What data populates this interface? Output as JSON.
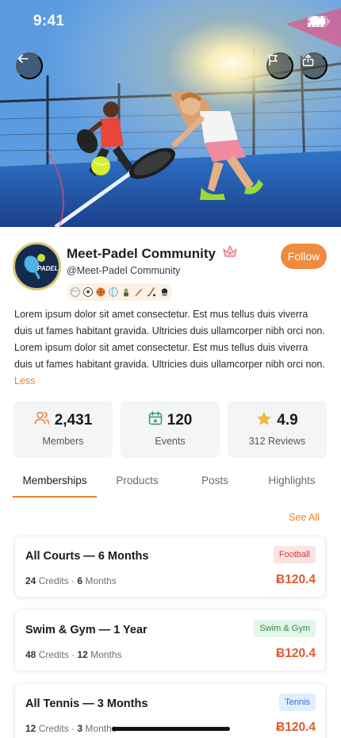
{
  "status_bar": {
    "time": "9:41"
  },
  "community": {
    "name": "Meet-Padel Community",
    "handle": "@Meet-Padel Community",
    "follow_label": "Follow",
    "logo_text": "PADEL",
    "sports_icons": [
      "tennis-ball-icon",
      "soccer-ball-icon",
      "basketball-icon",
      "volleyball-icon",
      "golf-icon",
      "padel-racket-icon",
      "hockey-icon",
      "boxing-glove-icon"
    ],
    "description": "Lorem ipsum dolor sit amet consectetur. Est mus tellus duis viverra duis ut fames habitant gravida. Ultricies duis ullamcorper nibh orci non. Lorem ipsum dolor sit amet consectetur. Est mus tellus duis viverra duis ut fames habitant gravida. Ultricies duis ullamcorper nibh orci non.",
    "less_label": "Less"
  },
  "stats": [
    {
      "value": "2,431",
      "label": "Members",
      "icon": "users-icon"
    },
    {
      "value": "120",
      "label": "Events",
      "icon": "calendar-icon"
    },
    {
      "value": "4.9",
      "label": "312 Reviews",
      "icon": "star-icon"
    }
  ],
  "tabs": [
    "Memberships",
    "Products",
    "Posts",
    "Highlights"
  ],
  "active_tab": "Memberships",
  "see_all_label": "See All",
  "memberships": [
    {
      "title": "All Courts — 6 Months",
      "credits": "24",
      "credits_label": "Credits",
      "months": "6",
      "months_label": "Months",
      "badge": "Football",
      "badge_bg": "#fde4e4",
      "badge_color": "#d23a3a",
      "price": "Ƀ120.4"
    },
    {
      "title": "Swim & Gym — 1 Year",
      "credits": "48",
      "credits_label": "Credits",
      "months": "12",
      "months_label": "Months",
      "badge": "Swim & Gym",
      "badge_bg": "#e3f6e8",
      "badge_color": "#2d8a4e",
      "price": "Ƀ120.4"
    },
    {
      "title": "All Tennis — 3 Months",
      "credits": "12",
      "credits_label": "Credits",
      "months": "3",
      "months_label": "Months",
      "badge": "Tennis",
      "badge_bg": "#e2eefc",
      "badge_color": "#2f6fd0",
      "price": "Ƀ120.4"
    }
  ],
  "colors": {
    "accent": "#ef7f2e",
    "price": "#e2582e"
  }
}
